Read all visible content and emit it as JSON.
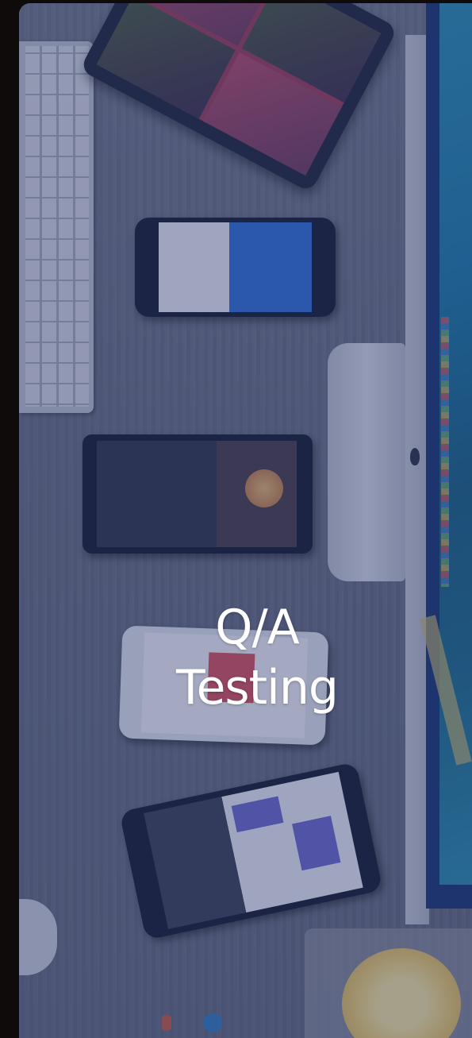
{
  "title": {
    "line1": "Q/A",
    "line2": "Testing"
  },
  "colors": {
    "overlay": "#28346e",
    "title_text": "#ffffff",
    "page_background": "#0e0b0a"
  },
  "icons": [
    "keyboard-image",
    "tablet-image",
    "phone-image",
    "monitor-image",
    "mug-image"
  ]
}
